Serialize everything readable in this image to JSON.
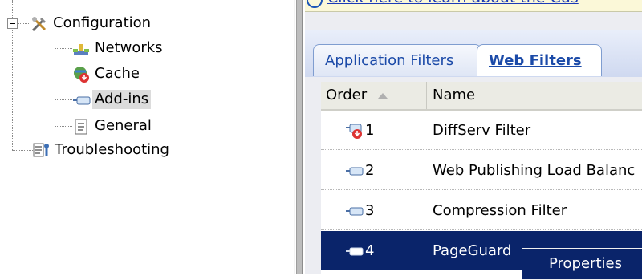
{
  "tree": {
    "items": [
      {
        "label": "Configuration",
        "icon": "tools-icon"
      },
      {
        "label": "Networks",
        "icon": "network-icon"
      },
      {
        "label": "Cache",
        "icon": "cache-icon"
      },
      {
        "label": "Add-ins",
        "icon": "addin-icon",
        "selected": true
      },
      {
        "label": "General",
        "icon": "general-icon"
      },
      {
        "label": "Troubleshooting",
        "icon": "troubleshooting-icon"
      }
    ]
  },
  "banner": {
    "link_text": "Click here to learn about the Cus"
  },
  "tabs": [
    {
      "label": "Application Filters",
      "active": false
    },
    {
      "label": "Web Filters",
      "active": true
    }
  ],
  "columns": {
    "order": "Order",
    "name": "Name"
  },
  "rows": [
    {
      "order": "1",
      "name": "DiffServ Filter",
      "icon": "filter-disabled-icon"
    },
    {
      "order": "2",
      "name": "Web Publishing Load Balanc",
      "icon": "plugin-icon"
    },
    {
      "order": "3",
      "name": "Compression Filter",
      "icon": "plugin-icon"
    },
    {
      "order": "4",
      "name": "PageGuard",
      "icon": "plugin-icon",
      "selected": true
    }
  ],
  "context_menu": {
    "item": "Properties"
  },
  "colors": {
    "selection": "#0a246a",
    "link": "#1b4aa8"
  }
}
